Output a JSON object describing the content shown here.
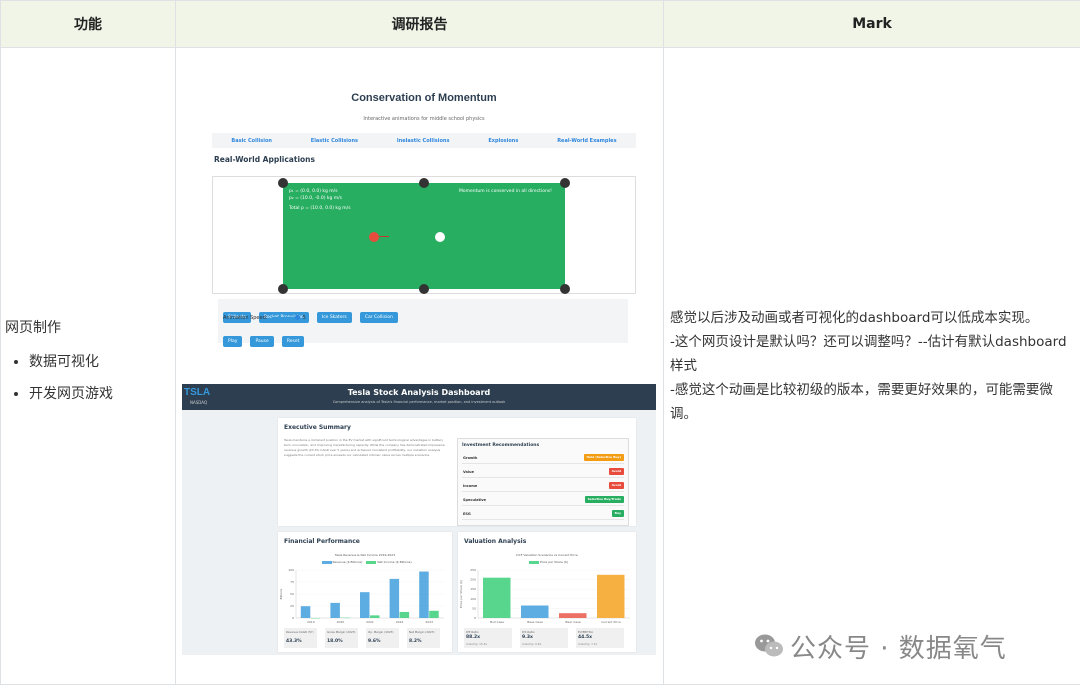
{
  "table": {
    "headers": [
      "功能",
      "调研报告",
      "Mark"
    ],
    "feature_title": "网页制作",
    "feature_items": [
      "数据可视化",
      "开发网页游戏"
    ],
    "mark_lines": [
      "感觉以后涉及动画或者可视化的dashboard可以低成本实现。",
      "-这个网页设计是默认吗？还可以调整吗？--估计有默认dashboard样式",
      "-感觉这个动画是比较初级的版本，需要更好效果的，可能需要微调。"
    ]
  },
  "momentum": {
    "title": "Conservation of Momentum",
    "subtitle": "Interactive animations for middle school physics",
    "nav": [
      "Basic Collision",
      "Elastic Collisions",
      "Inelastic Collisions",
      "Explosions",
      "Real-World Examples"
    ],
    "section_title": "Real-World Applications",
    "readout": [
      "p₁ = (0.0, 0.0) kg m/s",
      "p₂ = (10.0, -0.0) kg m/s",
      "Total p = (10.0, 0.0) kg m/s"
    ],
    "note": "Momentum is conserved in all directions!",
    "scenario_buttons": [
      "Billiards",
      "Rocket Propulsion",
      "Ice Skaters",
      "Car Collision"
    ],
    "speed_label": "Animation Speed:",
    "speed_value": "5",
    "play_buttons": [
      "Play",
      "Pause",
      "Reset"
    ],
    "colors": {
      "table": "#27ae60",
      "button": "#3498db",
      "ball_red": "#e74c3c",
      "ball_white": "#ffffff"
    }
  },
  "tesla": {
    "logo": "TSLA",
    "logo_sub": "NASDAQ",
    "title": "Tesla Stock Analysis Dashboard",
    "subtitle": "Comprehensive analysis of Tesla's financial performance, market position, and investment outlook",
    "exec_title": "Executive Summary",
    "exec_text": "Tesla maintains a dominant position in the EV market with significant technological advantages in battery tech, innovation, and improving manufacturing capacity. While the company has demonstrated impressive revenue growth (43.3% CAGR over 5 years) and achieved consistent profitability, our valuation analysis suggests the current stock price exceeds our calculated intrinsic value across multiple scenarios.",
    "rec_title": "Investment Recommendations",
    "recommendations": [
      {
        "label": "Growth",
        "tag": "Hold (Selective Buy)",
        "color": "#f39c12"
      },
      {
        "label": "Value",
        "tag": "Avoid",
        "color": "#e74c3c"
      },
      {
        "label": "Income",
        "tag": "Avoid",
        "color": "#e74c3c"
      },
      {
        "label": "Speculative",
        "tag": "Selective Buy/Trade",
        "color": "#27ae60"
      },
      {
        "label": "ESG",
        "tag": "Buy",
        "color": "#27ae60"
      }
    ],
    "fin_title": "Financial Performance",
    "val_title": "Valuation Analysis",
    "fin_metrics": [
      {
        "label": "Revenue CAGR (5Y)",
        "value": "43.3%"
      },
      {
        "label": "Gross Margin (2023)",
        "value": "18.0%"
      },
      {
        "label": "Op. Margin (2023)",
        "value": "9.6%"
      },
      {
        "label": "Net Margin (2023)",
        "value": "8.2%"
      }
    ],
    "val_metrics": [
      {
        "label": "P/E Ratio",
        "value": "88.2x",
        "sub": "Industry: 15.4x"
      },
      {
        "label": "P/S Ratio",
        "value": "9.3x",
        "sub": "Industry: 0.8x"
      },
      {
        "label": "EV/EBITDA",
        "value": "44.5x",
        "sub": "Industry: 7.2x"
      }
    ]
  },
  "chart_data": [
    {
      "type": "bar",
      "title": "Tesla Revenue & Net Income 2019-2023",
      "ylabel": "Billions",
      "categories": [
        "2019",
        "2020",
        "2021",
        "2022",
        "2023"
      ],
      "series": [
        {
          "name": "Revenue ($ Billions)",
          "color": "#5dade2",
          "values": [
            24.6,
            31.5,
            53.8,
            81.5,
            96.8
          ]
        },
        {
          "name": "Net Income ($ Billions)",
          "color": "#58d68d",
          "values": [
            -0.9,
            0.7,
            5.5,
            12.6,
            15.0
          ]
        }
      ],
      "ylim": [
        0,
        100
      ],
      "yticks": [
        "0",
        "25",
        "50",
        "75",
        "100"
      ]
    },
    {
      "type": "bar",
      "title": "DCF Valuation Scenarios vs Current Price",
      "ylabel": "Price per Share ($)",
      "categories": [
        "Bull Case",
        "Base Case",
        "Bear Case",
        "Current Price"
      ],
      "series": [
        {
          "name": "Price per Share ($)",
          "values": [
            210,
            65,
            25,
            225
          ]
        }
      ],
      "colors": [
        "#58d68d",
        "#5dade2",
        "#ec7063",
        "#f5b041"
      ],
      "ylim": [
        0,
        250
      ],
      "yticks": [
        "0",
        "50",
        "100",
        "150",
        "200",
        "250"
      ]
    }
  ],
  "watermark": {
    "text": "公众号 · 数据氧气",
    "icon": "wechat-icon"
  }
}
